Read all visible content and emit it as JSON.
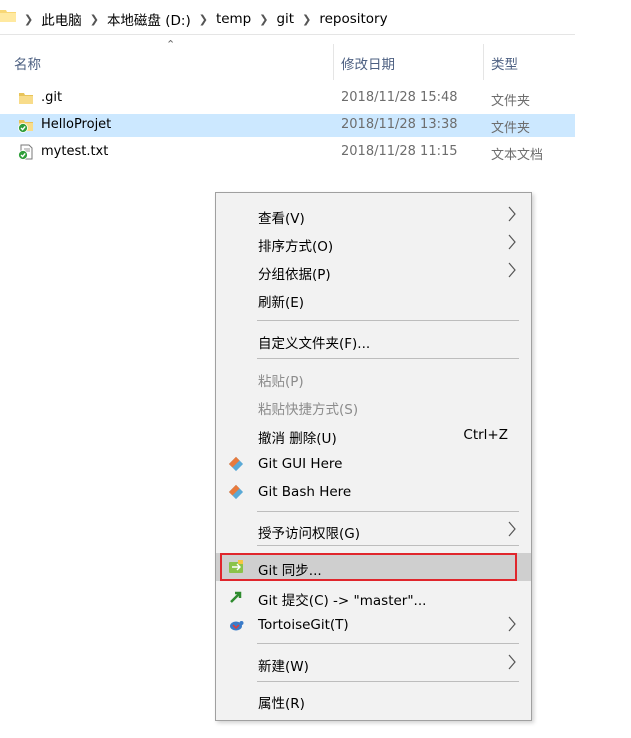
{
  "breadcrumb": {
    "items": [
      "此电脑",
      "本地磁盘 (D:)",
      "temp",
      "git",
      "repository"
    ]
  },
  "columns": {
    "name": "名称",
    "date": "修改日期",
    "type": "类型"
  },
  "files": [
    {
      "name": ".git",
      "date": "2018/11/28 15:48",
      "type": "文件夹",
      "icon": "folder-icon"
    },
    {
      "name": "HelloProjet",
      "date": "2018/11/28 13:38",
      "type": "文件夹",
      "icon": "git-synced-folder-icon"
    },
    {
      "name": "mytest.txt",
      "date": "2018/11/28 11:15",
      "type": "文本文档",
      "icon": "git-synced-text-file-icon"
    }
  ],
  "menu": {
    "view": "查看(V)",
    "sort": "排序方式(O)",
    "group": "分组依据(P)",
    "refresh": "刷新(E)",
    "customize": "自定义文件夹(F)...",
    "paste": "粘贴(P)",
    "paste_shortcut": "粘贴快捷方式(S)",
    "undo": "撤消 删除(U)",
    "undo_shortcut": "Ctrl+Z",
    "git_gui": "Git GUI Here",
    "git_bash": "Git Bash Here",
    "grant_access": "授予访问权限(G)",
    "git_sync": "Git 同步...",
    "git_commit": "Git 提交(C) -> \"master\"...",
    "tortoisegit": "TortoiseGit(T)",
    "new": "新建(W)",
    "properties": "属性(R)"
  },
  "colors": {
    "selection": "#cce8ff",
    "highlight_border": "#e0262c",
    "menu_bg": "#f2f2f2"
  }
}
